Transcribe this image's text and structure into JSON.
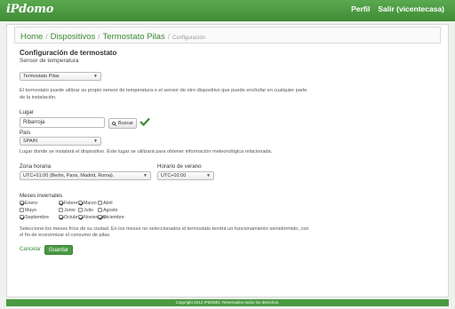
{
  "header": {
    "logo": "iPdomo",
    "nav": [
      "Perfil",
      "Salir (vicentecasa)"
    ]
  },
  "breadcrumb": {
    "items": [
      "Home",
      "Dispositivos",
      "Termostato Pilas"
    ],
    "current": "Configuración"
  },
  "page": {
    "title": "Configuración de termostato",
    "sensor_section": "Sensor de temperatura",
    "sensor_select": "Termostato Pilas",
    "sensor_help": "El termostato puede utilizar su propio sensor de temperatura o el sensor de otro dispositivo que puede enchufar en cualquier parte de la instalación.",
    "lugar_label": "Lugar",
    "lugar_value": "Ribarroja",
    "buscar_label": "Buscar",
    "pais_label": "País",
    "pais_value": "SPAIN",
    "lugar_help": "Lugar donde se instalará el dispositivo. Este lugar se utilizará para obtener información meteorológica relacionada.",
    "zona_label": "Zona horaria",
    "zona_value": "UTC+01:00 (Berlin, Paris, Madrid, Roma).",
    "verano_label": "Horario de verano",
    "verano_value": "UTC+02:00",
    "meses_label": "Meses invernales",
    "months": [
      {
        "name": "Enero",
        "checked": true
      },
      {
        "name": "Febrero",
        "checked": true
      },
      {
        "name": "Marzo",
        "checked": true
      },
      {
        "name": "Abril",
        "checked": false
      },
      {
        "name": "Mayo",
        "checked": false
      },
      {
        "name": "Junio",
        "checked": false
      },
      {
        "name": "Julio",
        "checked": false
      },
      {
        "name": "Agosto",
        "checked": false
      },
      {
        "name": "Septiembre",
        "checked": true
      },
      {
        "name": "Octubre",
        "checked": true
      },
      {
        "name": "Noviembre",
        "checked": true
      },
      {
        "name": "Diciembre",
        "checked": true
      }
    ],
    "meses_help": "Seleccione los meses fríos de su ciudad. En los meses no seleccionados el termostato tendrá un funcionamiento semidormido, con el fin de economizar el consumo de pilas.",
    "cancel_label": "Cancelar",
    "save_label": "Guardar"
  },
  "footer": {
    "text": "Copyright 2012 IPDOMO. Reservados todos los derechos."
  },
  "colors": {
    "brand_green": "#4a9a42",
    "link_green": "#3c8a34"
  }
}
